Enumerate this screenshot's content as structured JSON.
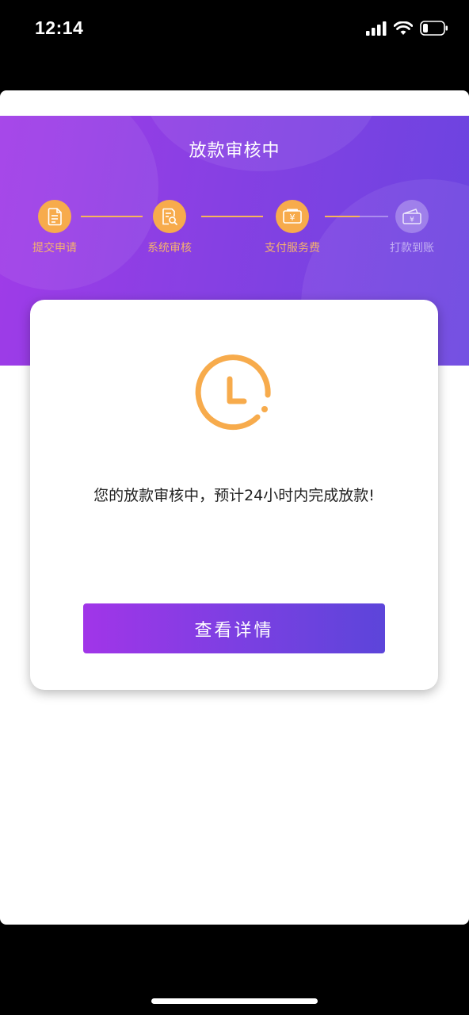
{
  "status_bar": {
    "time": "12:14",
    "icons": [
      "signal-icon",
      "wifi-icon",
      "battery-icon"
    ]
  },
  "header": {
    "title": "放款审核中"
  },
  "steps": [
    {
      "label": "提交申请",
      "icon": "document-icon",
      "state": "done"
    },
    {
      "label": "系统审核",
      "icon": "document-search-icon",
      "state": "done"
    },
    {
      "label": "支付服务费",
      "icon": "payment-icon",
      "state": "done"
    },
    {
      "label": "打款到账",
      "icon": "wallet-icon",
      "state": "pending"
    }
  ],
  "card": {
    "icon": "clock-icon",
    "message": "您的放款审核中，预计24小时内完成放款!",
    "button_label": "查看详情"
  },
  "colors": {
    "accent_orange": "#f7ab4c",
    "gradient_start": "#a13be8",
    "gradient_end": "#5c45da"
  }
}
